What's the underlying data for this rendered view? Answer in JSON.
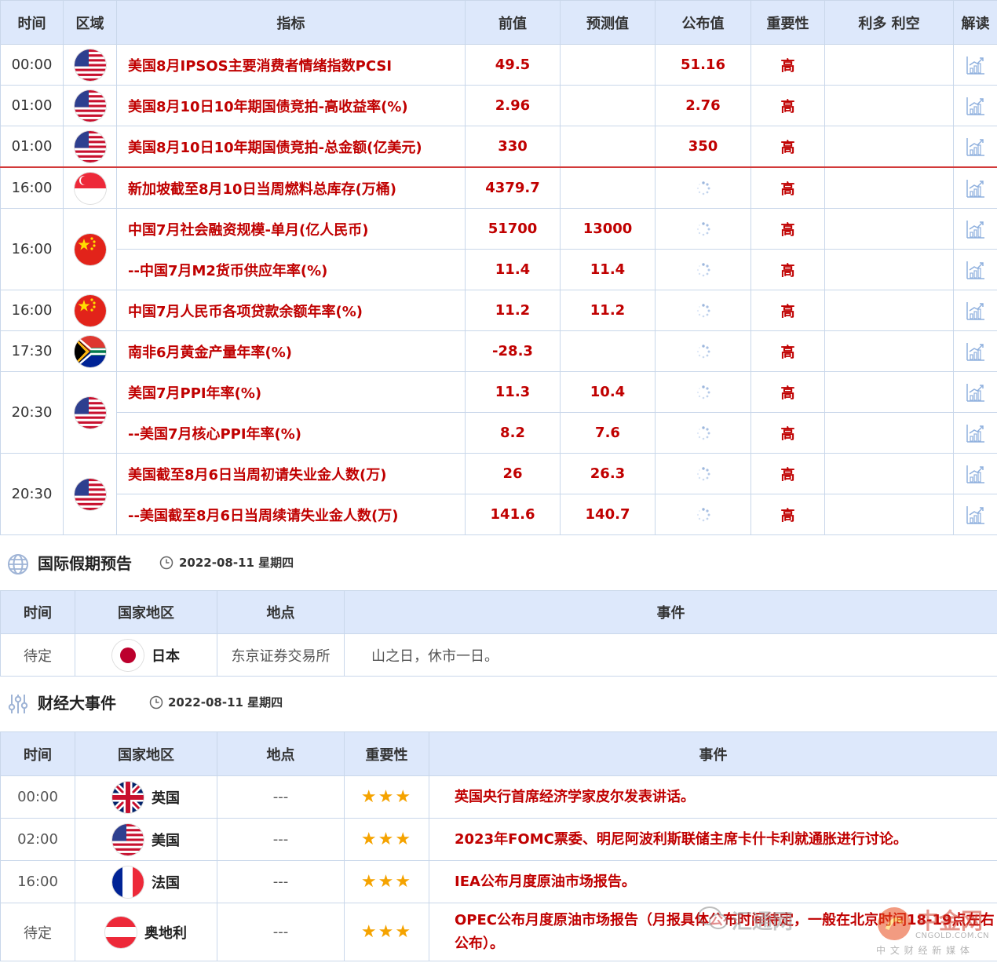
{
  "calendar": {
    "headers": [
      "时间",
      "区域",
      "指标",
      "前值",
      "预测值",
      "公布值",
      "重要性",
      "利多 利空",
      "解读"
    ],
    "rows": [
      {
        "time": "00:00",
        "flag": "us",
        "indicator": "美国8月IPSOS主要消费者情绪指数PCSI",
        "prev": "49.5",
        "forecast": "",
        "actual": "51.16",
        "importance": "高"
      },
      {
        "time": "01:00",
        "flag": "us",
        "indicator": "美国8月10日10年期国债竞拍-高收益率(%)",
        "prev": "2.96",
        "forecast": "",
        "actual": "2.76",
        "importance": "高"
      },
      {
        "time": "01:00",
        "flag": "us",
        "indicator": "美国8月10日10年期国债竞拍-总金额(亿美元)",
        "prev": "330",
        "forecast": "",
        "actual": "350",
        "importance": "高"
      },
      {
        "time": "16:00",
        "flag": "sg",
        "indicator": "新加坡截至8月10日当周燃料总库存(万桶)",
        "prev": "4379.7",
        "forecast": "",
        "actual": "",
        "importance": "高"
      },
      {
        "time": "16:00",
        "flag": "cn",
        "indicator": "中国7月社会融资规模-单月(亿人民币)",
        "prev": "51700",
        "forecast": "13000",
        "actual": "",
        "importance": "高"
      },
      {
        "indicator": "--中国7月M2货币供应年率(%)",
        "prev": "11.4",
        "forecast": "11.4",
        "actual": "",
        "importance": "高"
      },
      {
        "time": "16:00",
        "flag": "cn",
        "indicator": "中国7月人民币各项贷款余额年率(%)",
        "prev": "11.2",
        "forecast": "11.2",
        "actual": "",
        "importance": "高"
      },
      {
        "time": "17:30",
        "flag": "za",
        "indicator": "南非6月黄金产量年率(%)",
        "prev": "-28.3",
        "forecast": "",
        "actual": "",
        "importance": "高"
      },
      {
        "time": "20:30",
        "flag": "us",
        "indicator": "美国7月PPI年率(%)",
        "prev": "11.3",
        "forecast": "10.4",
        "actual": "",
        "importance": "高"
      },
      {
        "indicator": "--美国7月核心PPI年率(%)",
        "prev": "8.2",
        "forecast": "7.6",
        "actual": "",
        "importance": "高"
      },
      {
        "time": "20:30",
        "flag": "us",
        "indicator": "美国截至8月6日当周初请失业金人数(万)",
        "prev": "26",
        "forecast": "26.3",
        "actual": "",
        "importance": "高"
      },
      {
        "indicator": "--美国截至8月6日当周续请失业金人数(万)",
        "prev": "141.6",
        "forecast": "140.7",
        "actual": "",
        "importance": "高"
      }
    ]
  },
  "holiday": {
    "title": "国际假期预告",
    "date": "2022-08-11 星期四",
    "headers": [
      "时间",
      "国家地区",
      "地点",
      "事件"
    ],
    "rows": [
      {
        "time": "待定",
        "flag": "jp",
        "country": "日本",
        "place": "东京证券交易所",
        "event": "山之日，休市一日。"
      }
    ]
  },
  "events": {
    "title": "财经大事件",
    "date": "2022-08-11 星期四",
    "headers": [
      "时间",
      "国家地区",
      "地点",
      "重要性",
      "事件"
    ],
    "rows": [
      {
        "time": "00:00",
        "flag": "uk",
        "country": "英国",
        "place": "---",
        "stars": "★★★",
        "event": "英国央行首席经济学家皮尔发表讲话。"
      },
      {
        "time": "02:00",
        "flag": "us",
        "country": "美国",
        "place": "---",
        "stars": "★★★",
        "event": "2023年FOMC票委、明尼阿波利斯联储主席卡什卡利就通胀进行讨论。"
      },
      {
        "time": "16:00",
        "flag": "fr",
        "country": "法国",
        "place": "---",
        "stars": "★★★",
        "event": "IEA公布月度原油市场报告。"
      },
      {
        "time": "待定",
        "flag": "at",
        "country": "奥地利",
        "place": "---",
        "stars": "★★★",
        "event": "OPEC公布月度原油市场报告（月报具体公布时间待定，一般在北京时间18-19点左右公布）。"
      }
    ]
  },
  "watermark": {
    "text1": "汇通网",
    "text2": "中金网",
    "text3": "CNGOLD.COM.CN",
    "text4": "中 文 财 经 新 媒 体"
  },
  "colors": {
    "header_bg": "#dde8fb",
    "accent_red": "#c00000",
    "border": "#c9d7ea",
    "star": "#f5a300"
  }
}
